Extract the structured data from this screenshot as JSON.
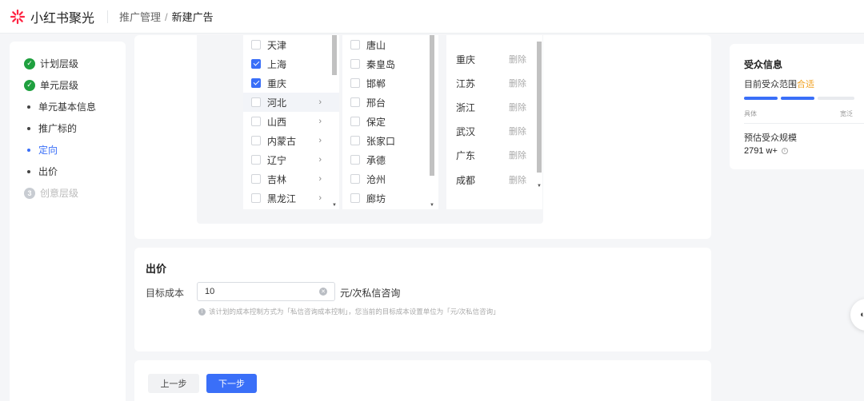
{
  "header": {
    "brand": "小红书聚光",
    "breadcrumb": [
      "推广管理",
      "新建广告"
    ],
    "separator": "/"
  },
  "steps": [
    {
      "label": "计划层级",
      "state": "done"
    },
    {
      "label": "单元层级",
      "state": "done"
    },
    {
      "label": "单元基本信息",
      "state": "sub"
    },
    {
      "label": "推广标的",
      "state": "sub"
    },
    {
      "label": "定向",
      "state": "sub-active"
    },
    {
      "label": "出价",
      "state": "sub"
    },
    {
      "label": "创意层级",
      "state": "todo",
      "number": "3"
    }
  ],
  "region": {
    "provinces": [
      {
        "name": "天津",
        "checked": false,
        "has_children": false
      },
      {
        "name": "上海",
        "checked": true,
        "has_children": false
      },
      {
        "name": "重庆",
        "checked": true,
        "has_children": false
      },
      {
        "name": "河北",
        "checked": false,
        "has_children": true,
        "highlighted": true
      },
      {
        "name": "山西",
        "checked": false,
        "has_children": true
      },
      {
        "name": "内蒙古",
        "checked": false,
        "has_children": true
      },
      {
        "name": "辽宁",
        "checked": false,
        "has_children": true
      },
      {
        "name": "吉林",
        "checked": false,
        "has_children": true
      },
      {
        "name": "黑龙江",
        "checked": false,
        "has_children": true
      }
    ],
    "cities": [
      {
        "name": "唐山",
        "checked": false
      },
      {
        "name": "秦皇岛",
        "checked": false
      },
      {
        "name": "邯郸",
        "checked": false
      },
      {
        "name": "邢台",
        "checked": false
      },
      {
        "name": "保定",
        "checked": false
      },
      {
        "name": "张家口",
        "checked": false
      },
      {
        "name": "承德",
        "checked": false
      },
      {
        "name": "沧州",
        "checked": false
      },
      {
        "name": "廊坊",
        "checked": false
      }
    ],
    "selected": [
      {
        "name": "重庆",
        "action": "删除"
      },
      {
        "name": "江苏",
        "action": "删除"
      },
      {
        "name": "浙江",
        "action": "删除"
      },
      {
        "name": "武汉",
        "action": "删除"
      },
      {
        "name": "广东",
        "action": "删除"
      },
      {
        "name": "成都",
        "action": "删除"
      }
    ]
  },
  "bid": {
    "title": "出价",
    "label": "目标成本",
    "value": "10",
    "unit": "元/次私信咨询",
    "hint": "该计划的成本控制方式为「私信咨询成本控制」，您当前的目标成本设置单位为「元/次私信咨询」"
  },
  "footer": {
    "prev": "上一步",
    "next": "下一步"
  },
  "audience": {
    "title": "受众信息",
    "range_label": "目前受众范围",
    "range_status": "合适",
    "range_level": 0.67,
    "min_label": "具体",
    "max_label": "宽泛",
    "scale_label": "预估受众规模",
    "scale_value": "2791 w+",
    "info_icon": "info-icon"
  },
  "colors": {
    "accent": "#3a6ff8",
    "success": "#1fa03f",
    "warning": "#f0a020"
  }
}
